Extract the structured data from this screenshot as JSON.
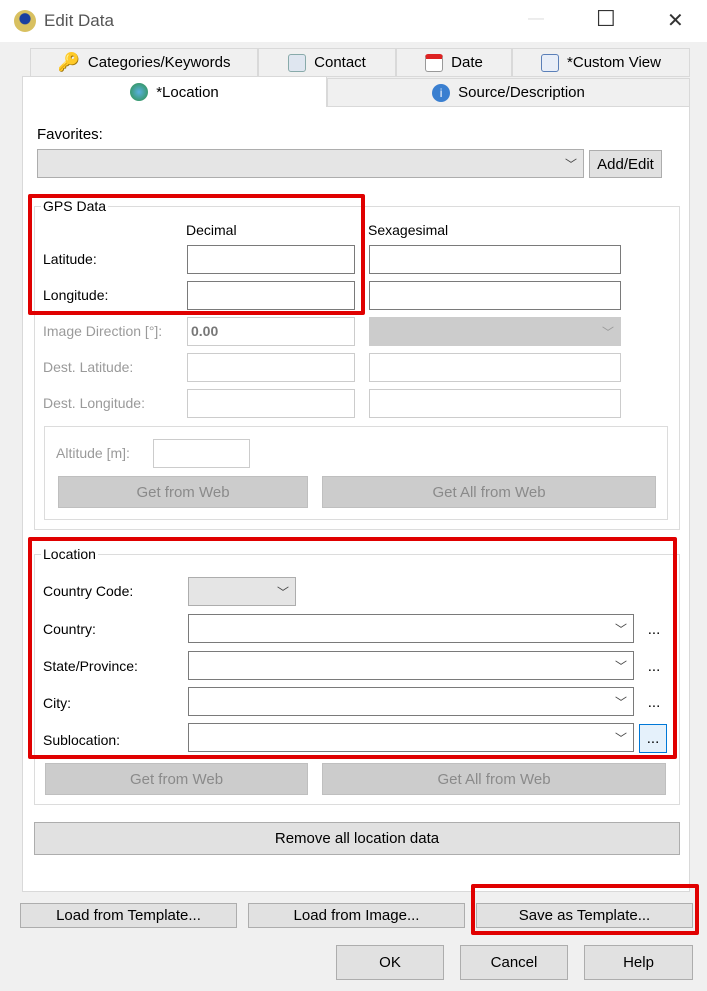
{
  "window": {
    "title": "Edit Data",
    "minimize": "—",
    "maximize": "☐",
    "close": "✕"
  },
  "tabs_row1": [
    {
      "label": "Categories/Keywords",
      "icon": "key-icon"
    },
    {
      "label": "Contact",
      "icon": "contact-card-icon"
    },
    {
      "label": "Date",
      "icon": "calendar-icon"
    },
    {
      "label": "*Custom View",
      "icon": "table-icon"
    }
  ],
  "tabs_row2": [
    {
      "label": "*Location",
      "icon": "globe-icon",
      "selected": true
    },
    {
      "label": "Source/Description",
      "icon": "info-icon"
    }
  ],
  "favorites": {
    "label": "Favorites:",
    "value": "",
    "add_edit": "Add/Edit"
  },
  "gps": {
    "title": "GPS Data",
    "decimal": "Decimal",
    "sexagesimal": "Sexagesimal",
    "latitude": "Latitude:",
    "longitude": "Longitude:",
    "image_direction": "Image Direction [°]:",
    "image_direction_value": "0.00",
    "dest_latitude": "Dest. Latitude:",
    "dest_longitude": "Dest. Longitude:",
    "altitude": "Altitude [m]:",
    "get_from_web": "Get from Web",
    "get_all_from_web": "Get All from Web"
  },
  "location": {
    "title": "Location",
    "country_code": "Country Code:",
    "country": "Country:",
    "state": "State/Province:",
    "city": "City:",
    "sublocation": "Sublocation:",
    "more": "...",
    "get_from_web": "Get from Web",
    "get_all_from_web": "Get All from Web"
  },
  "remove_all": "Remove all location data",
  "bottom": {
    "load_template": "Load from Template...",
    "load_image": "Load from Image...",
    "save_template": "Save as Template...",
    "ok": "OK",
    "cancel": "Cancel",
    "help": "Help"
  },
  "colors": {
    "highlight": "#e00000",
    "dialog_bg": "#f0f0f0"
  }
}
